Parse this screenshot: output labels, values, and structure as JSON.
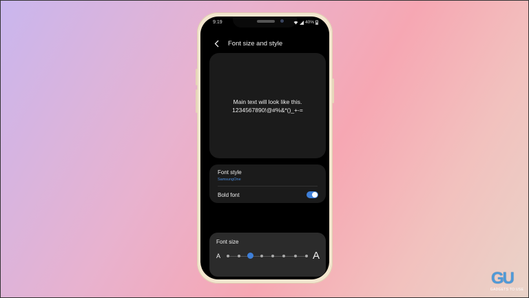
{
  "status_bar": {
    "time": "9:19",
    "battery": "40%"
  },
  "header": {
    "title": "Font size and style"
  },
  "preview": {
    "line1": "Main text will look like this.",
    "line2": "1234567890!@#%&*()_+-="
  },
  "font_style": {
    "label": "Font style",
    "value": "SamsungOne"
  },
  "bold_font": {
    "label": "Bold font",
    "enabled": true
  },
  "font_size": {
    "label": "Font size",
    "small_glyph": "A",
    "large_glyph": "A",
    "steps": 8,
    "selected_step": 3
  },
  "watermark": {
    "text": "GADGETS TO USE",
    "mark": "GU"
  },
  "colors": {
    "accent": "#3e7fd8",
    "link": "#4a8de0",
    "screen_bg": "#000000",
    "card_bg": "#1b1b1b"
  }
}
